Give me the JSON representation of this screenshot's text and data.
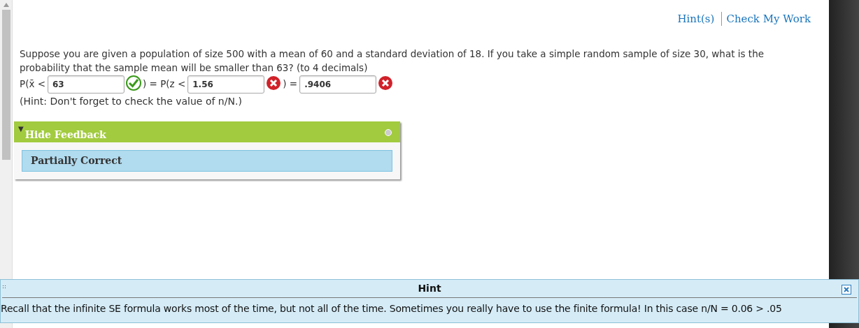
{
  "links": [
    "Hint(s)",
    "Check My Work"
  ],
  "question": "Suppose you are given a population of size 500 with a mean of 60 and a standard deviation of 18. If you take a simple random sample of size 30, what is the probability that the sample mean will be smaller than 63? (to 4 decimals)",
  "answer_parts": [
    {
      "prefix": "P(x̄ <",
      "value": "63",
      "correct": true
    },
    {
      "prefix": ") = P(z <",
      "value": "1.56",
      "correct": false
    },
    {
      "prefix": ") =",
      "value": ".9406",
      "correct": false
    }
  ],
  "hint_line": "(Hint: Don't forget to check the value of n/N.)",
  "feedback": {
    "toggle": "▼",
    "title": "Hide Feedback",
    "expanded": true,
    "result": "Partially Correct"
  },
  "hint_panel": {
    "title": "Hint",
    "text": "Recall that the infinite SE formula works most of the time, but not all of the time. Sometimes you really have to use the finite formula! In this case n/N = 0.06 > .05"
  }
}
